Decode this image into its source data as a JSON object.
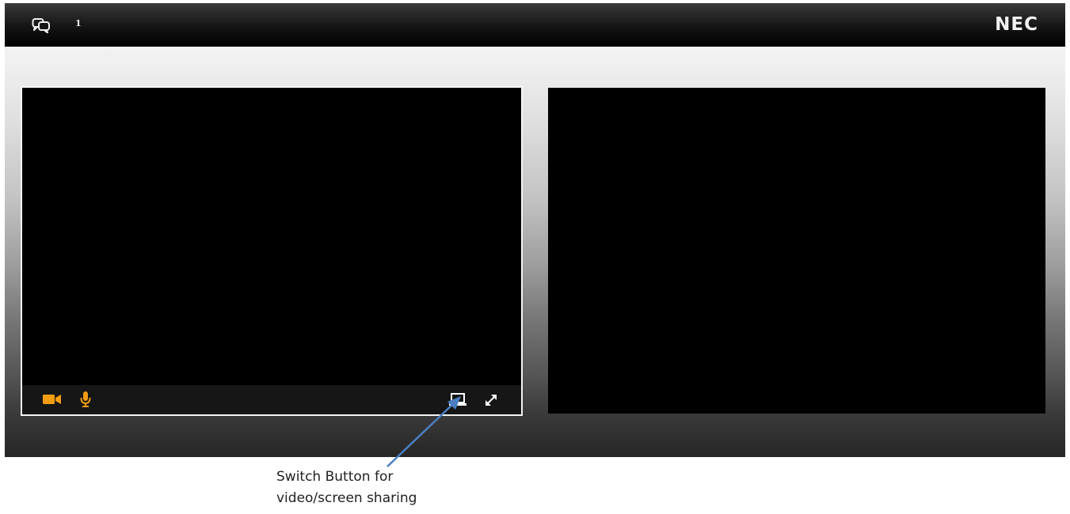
{
  "topbar": {
    "chat_icon": "chat-bubbles-icon",
    "count": "1",
    "logo": "NEC"
  },
  "local_video": {
    "controls": {
      "camera_icon": "video-camera-icon",
      "mic_icon": "microphone-icon",
      "switch_icon": "screen-share-switch-icon",
      "expand_icon": "expand-icon"
    }
  },
  "annotation": {
    "line1": "Switch Button for",
    "line2": "video/screen sharing"
  },
  "colors": {
    "accent": "#f39c12",
    "arrow": "#4a7fc1"
  }
}
